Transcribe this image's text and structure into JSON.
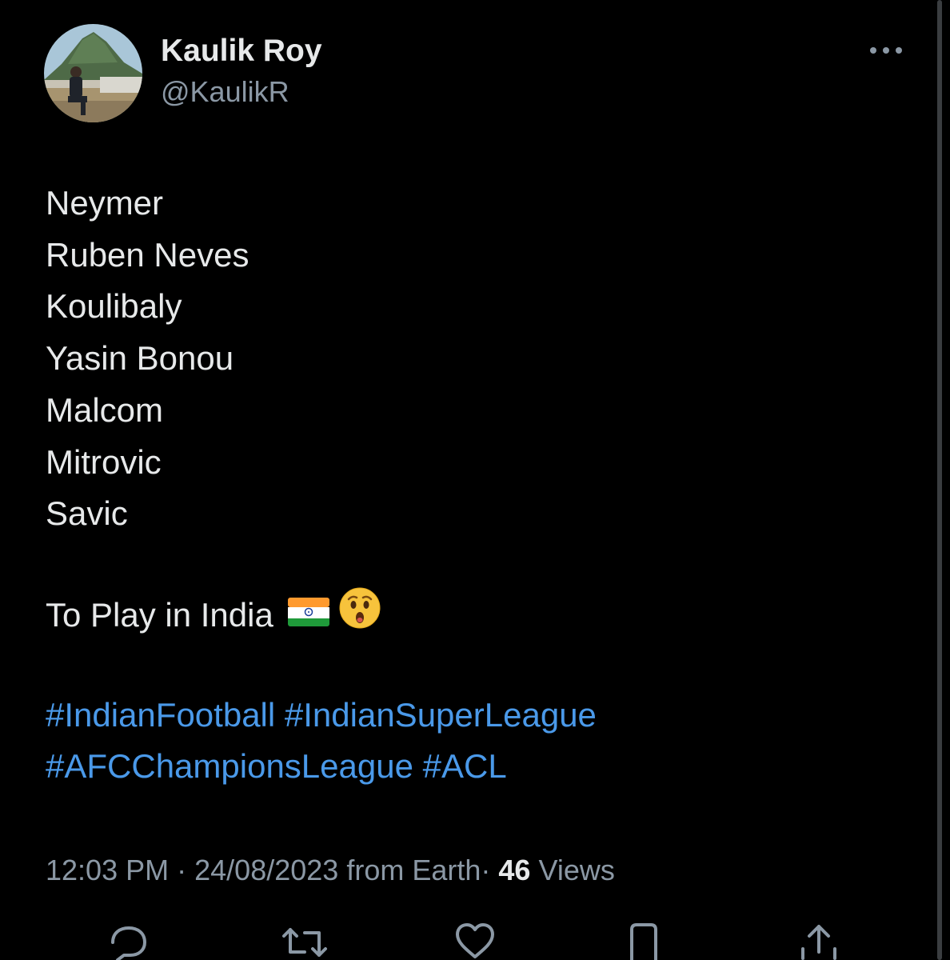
{
  "author": {
    "display_name": "Kaulik Roy",
    "handle": "@KaulikR",
    "avatar_icon": "profile-photo"
  },
  "more_icon": "ellipsis-icon",
  "body": {
    "lines": [
      "Neymer",
      "Ruben Neves",
      "Koulibaly",
      "Yasin Bonou",
      "Malcom",
      "Mitrovic",
      "Savic"
    ],
    "closing_text": "To Play in India",
    "emojis": [
      "india-flag",
      "astonished-face"
    ]
  },
  "hashtags": {
    "line1": [
      "#IndianFootball",
      "#IndianSuperLeague"
    ],
    "line2": [
      "#AFCChampionsLeague",
      "#ACL"
    ]
  },
  "meta": {
    "time": "12:03 PM",
    "separator": "·",
    "date": "24/08/2023",
    "source": "from Earth",
    "views_count": "46",
    "views_label": "Views"
  },
  "actions": [
    "reply-icon",
    "retweet-icon",
    "like-icon",
    "bookmark-icon",
    "share-icon"
  ],
  "colors": {
    "background": "#000000",
    "text_primary": "#e7e9ea",
    "text_secondary": "#8b98a5",
    "link": "#4a99e9"
  }
}
